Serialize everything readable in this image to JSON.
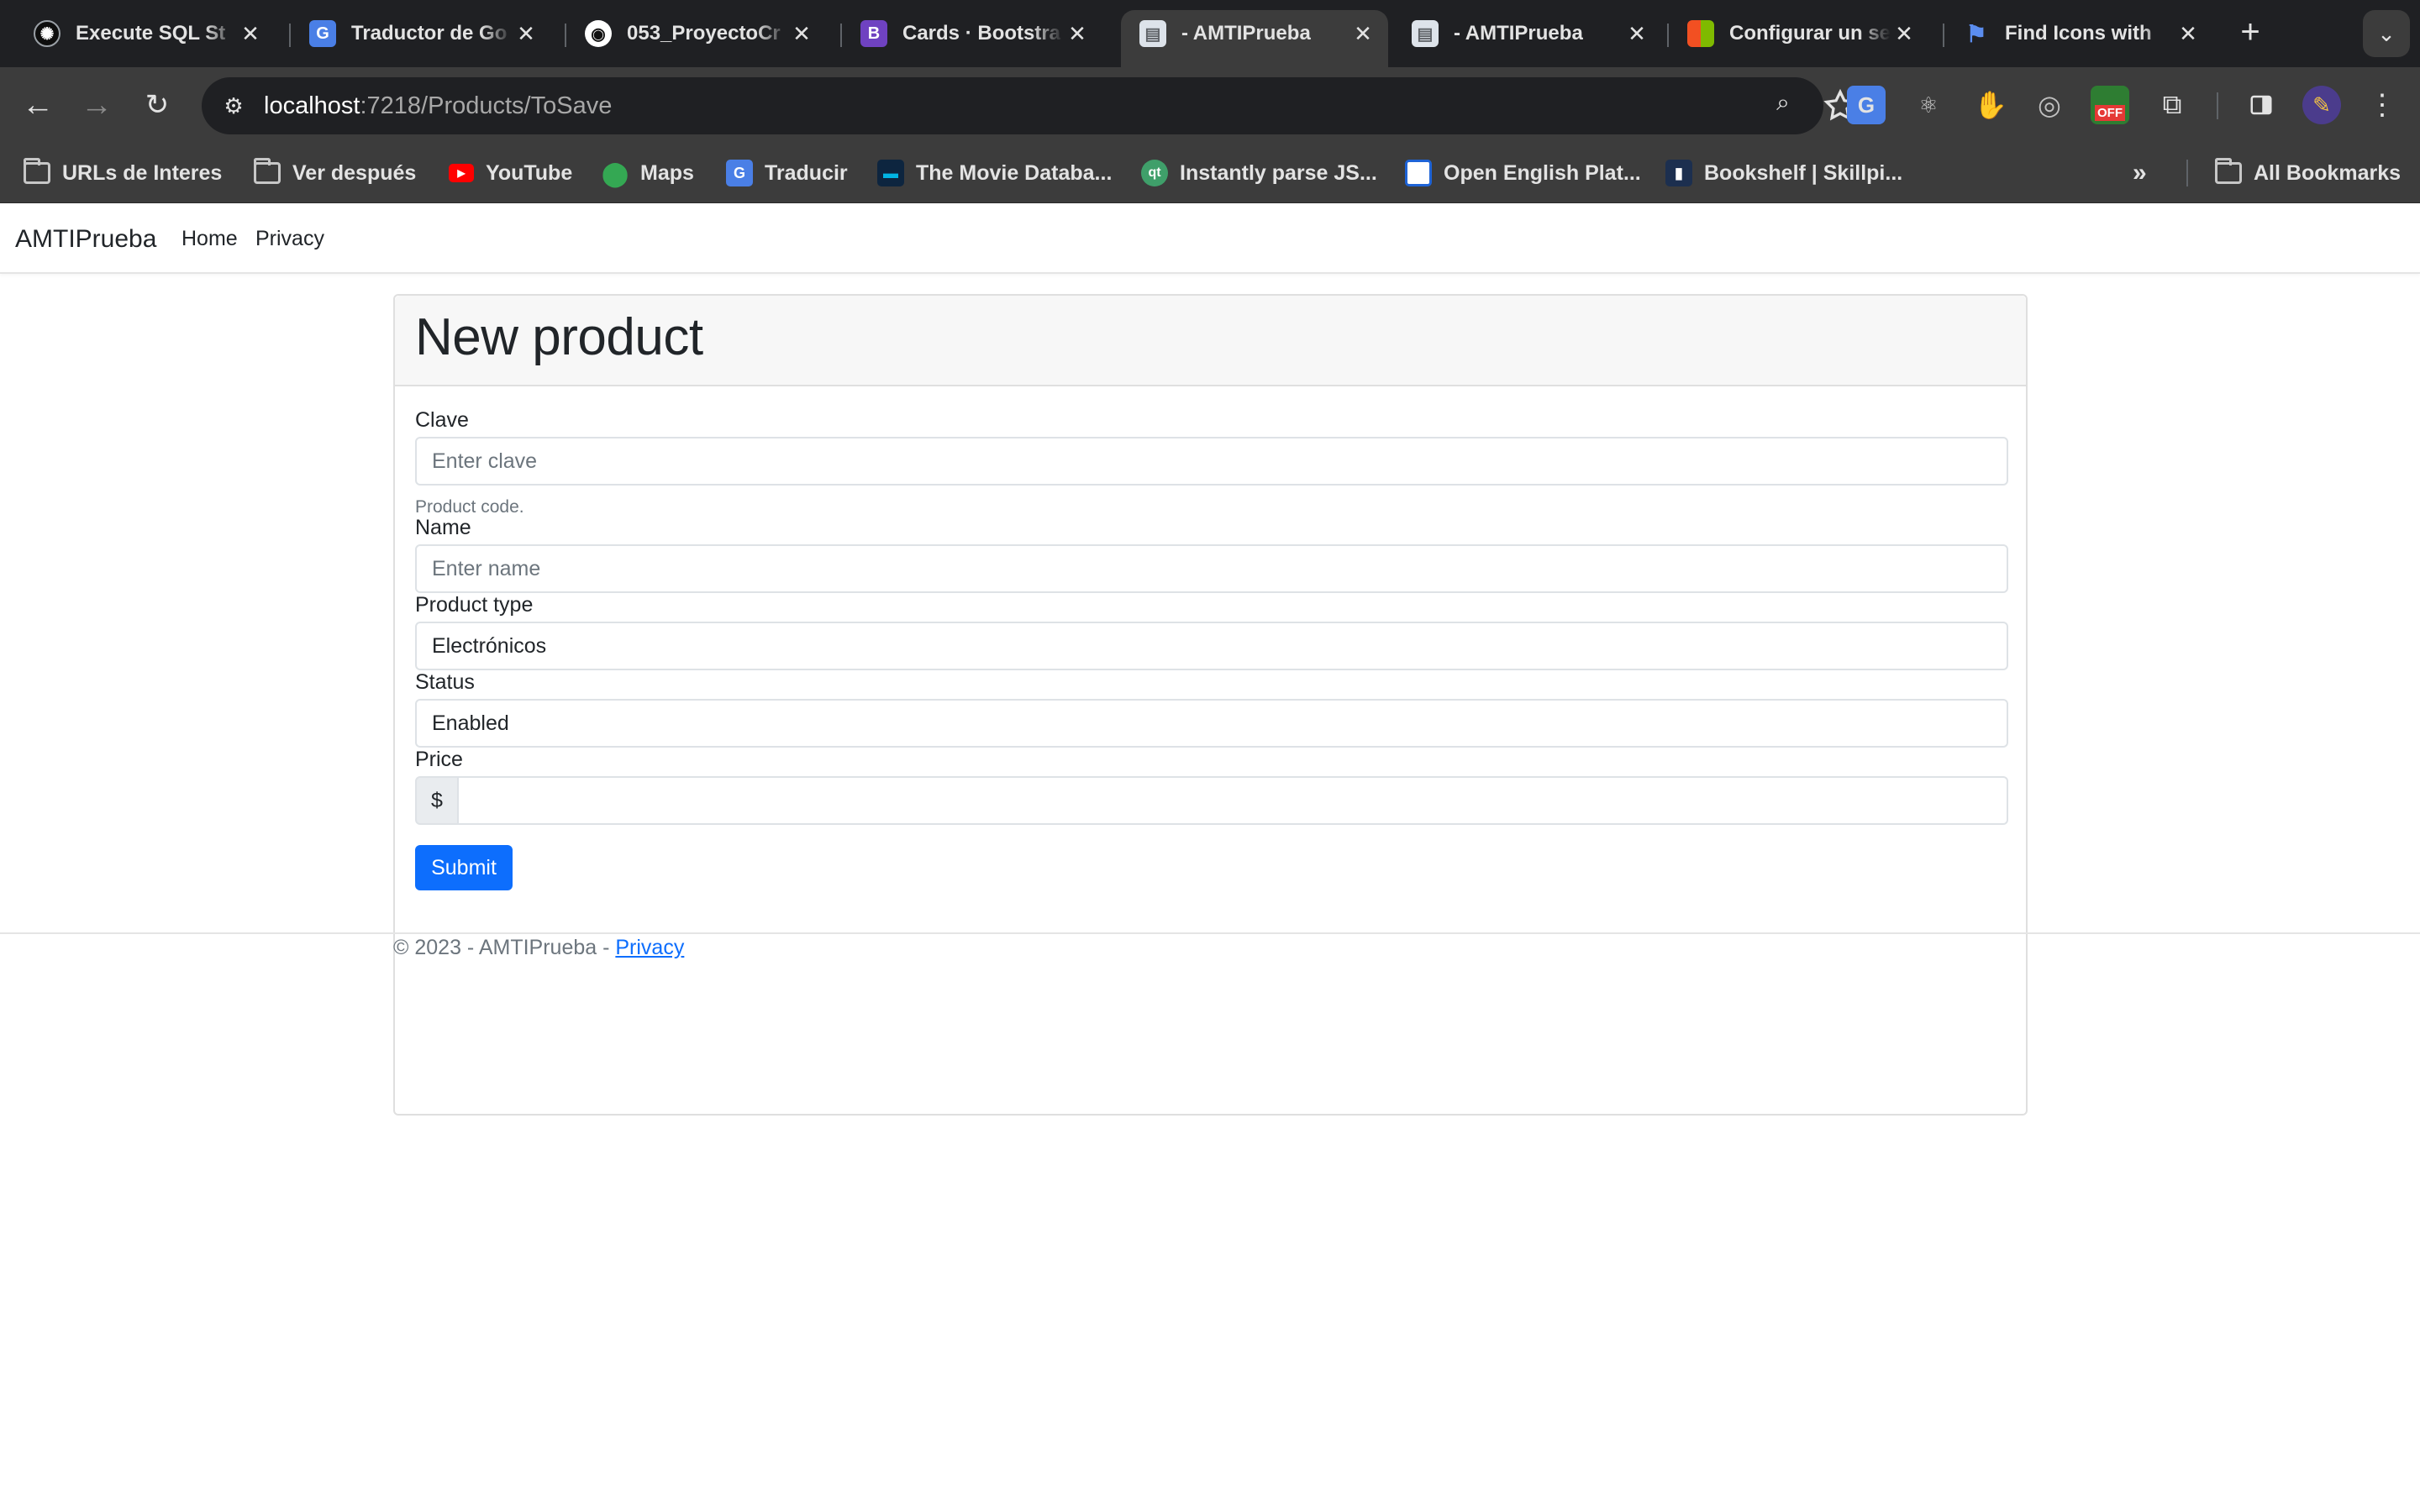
{
  "tabs": [
    {
      "title": "Execute SQL St",
      "icon": "openai-icon"
    },
    {
      "title": "Traductor de Go",
      "icon": "google-translate-icon"
    },
    {
      "title": "053_ProyectoCr",
      "icon": "github-icon"
    },
    {
      "title": "Cards · Bootstra",
      "icon": "bootstrap-icon"
    },
    {
      "title": "- AMTIPrueba",
      "icon": "document-icon"
    },
    {
      "title": "- AMTIPrueba",
      "icon": "document-icon"
    },
    {
      "title": "Configurar un se",
      "icon": "microsoft-icon"
    },
    {
      "title": "Find Icons with",
      "icon": "flag-icon"
    }
  ],
  "address_bar": {
    "host": "localhost",
    "path": ":7218/Products/ToSave"
  },
  "bookmarks": [
    {
      "label": "URLs de Interes",
      "icon": "folder-icon"
    },
    {
      "label": "Ver después",
      "icon": "folder-icon"
    },
    {
      "label": "YouTube",
      "icon": "youtube-icon"
    },
    {
      "label": "Maps",
      "icon": "maps-icon"
    },
    {
      "label": "Traducir",
      "icon": "google-translate-icon"
    },
    {
      "label": "The Movie Databa...",
      "icon": "tmdb-icon"
    },
    {
      "label": "Instantly parse JS...",
      "icon": "quicktype-icon"
    },
    {
      "label": "Open English Plat...",
      "icon": "open-english-icon"
    },
    {
      "label": "Bookshelf | Skillpi...",
      "icon": "book-icon"
    }
  ],
  "all_bookmarks_label": "All Bookmarks",
  "site": {
    "brand": "AMTIPrueba",
    "nav": [
      "Home",
      "Privacy"
    ]
  },
  "form": {
    "title": "New product",
    "clave": {
      "label": "Clave",
      "placeholder": "Enter clave",
      "help": "Product code."
    },
    "name": {
      "label": "Name",
      "placeholder": "Enter name"
    },
    "product_type": {
      "label": "Product type",
      "value": "Electrónicos"
    },
    "status": {
      "label": "Status",
      "value": "Enabled"
    },
    "price": {
      "label": "Price",
      "prefix": "$",
      "value": ""
    },
    "submit_label": "Submit"
  },
  "footer": {
    "text": "© 2023 - AMTIPrueba - ",
    "link": "Privacy"
  },
  "colors": {
    "primary": "#0d6efd",
    "chrome_dark": "#1f2023",
    "chrome_toolbar": "#3c3c3c"
  }
}
